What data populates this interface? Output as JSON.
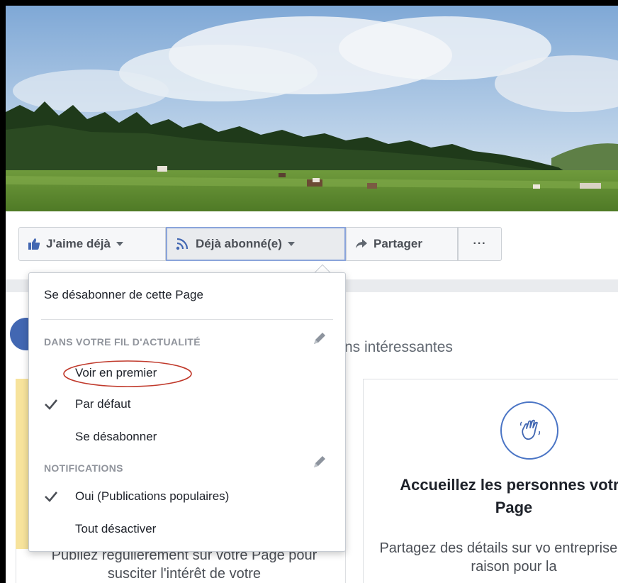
{
  "actions": {
    "like_label": "J'aime déjà",
    "follow_label": "Déjà abonné(e)",
    "share_label": "Partager",
    "more_label": "···"
  },
  "menu": {
    "unfollow_page": "Se désabonner de cette Page",
    "news_feed_header": "DANS VOTRE FIL D'ACTUALITÉ",
    "see_first": "Voir en premier",
    "default": "Par défaut",
    "unfollow": "Se désabonner",
    "notifications_header": "NOTIFICATIONS",
    "notif_highlights": "Oui (Publications populaires)",
    "notif_off": "Tout désactiver"
  },
  "background": {
    "heading_partial": "ns intéressantes",
    "left_card_text": "Publiez régulièrement sur votre Page pour susciter l'intérêt de votre",
    "welcome_title": "Accueillez les personnes votre Page",
    "welcome_text": "Partagez des détails sur vo entreprise et la raison pour la"
  },
  "colors": {
    "accent": "#4267b2",
    "annotation": "#c0392b"
  },
  "icons": {
    "like": "thumbs-up-icon",
    "follow": "rss-icon",
    "share": "share-arrow-icon",
    "edit": "pencil-icon",
    "check": "checkmark-icon",
    "welcome": "waving-hand-icon"
  }
}
